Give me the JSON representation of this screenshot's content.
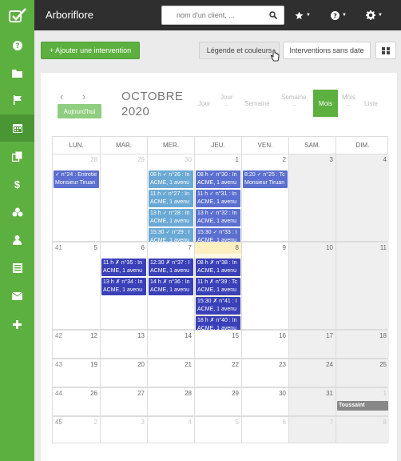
{
  "app": {
    "title": "Arboriflore",
    "colors": {
      "brand": "#5cb040",
      "topbar": "#2f2f2f",
      "event_violet": "#5b6fd0",
      "event_light": "#6aa9d5",
      "event_dark": "#3a40b8"
    }
  },
  "search": {
    "placeholder": "nom d'un client, ..."
  },
  "sidebar": {
    "items": [
      {
        "icon": "help-icon"
      },
      {
        "icon": "folder-icon"
      },
      {
        "icon": "flag-icon"
      },
      {
        "icon": "calendar-icon",
        "active": true
      },
      {
        "icon": "copy-icon"
      },
      {
        "icon": "dollar-icon"
      },
      {
        "icon": "cubes-icon"
      },
      {
        "icon": "user-icon"
      },
      {
        "icon": "list-icon"
      },
      {
        "icon": "envelope-icon"
      },
      {
        "icon": "plus-icon"
      }
    ]
  },
  "toolbar": {
    "add_label": "+ Ajouter une intervention",
    "legend_label": "Légende et couleurs",
    "no_date_label": "Interventions sans date"
  },
  "calendar": {
    "today_label": "Aujourd'hui",
    "month": "OCTOBRE",
    "year": "2020",
    "views": [
      {
        "label": "Jour",
        "sub": ""
      },
      {
        "label": "Jour",
        "sub": "--"
      },
      {
        "label": "Semaine",
        "sub": ""
      },
      {
        "label": "Semaine",
        "sub": "--"
      },
      {
        "label": "Mois",
        "sub": "",
        "active": true
      },
      {
        "label": "Mois",
        "sub": "--"
      },
      {
        "label": "Liste",
        "sub": ""
      }
    ],
    "days_of_week": [
      "LUN.",
      "MAR.",
      "MER.",
      "JEU.",
      "VEN.",
      "SAM.",
      "DIM."
    ],
    "weeks": [
      {
        "number": "",
        "days": [
          "",
          "29",
          "30",
          "1",
          "2",
          "3",
          "4"
        ],
        "first": "28",
        "events": [
          [
            {
              "l1": "✓ n°24 : Entretie",
              "l2": "Monsieur Tiruan",
              "c": "violet"
            }
          ],
          [],
          [
            {
              "l1": "08 h ✓ n°26 : In",
              "l2": "ACME, 1 avenu",
              "c": "light"
            },
            {
              "l1": "11 h ✓ n°27 : In",
              "l2": "ACME, 1 avenu",
              "c": "light"
            },
            {
              "l1": "13 h ✓ n°28 : In",
              "l2": "ACME, 1 avenu",
              "c": "light"
            },
            {
              "l1": "15:30 ✓ n°29 : I",
              "l2": "ACME, 1 avenu",
              "c": "light"
            }
          ],
          [
            {
              "l1": "08 h ✓ n°30 : In",
              "l2": "ACME, 1 avenu",
              "c": "violet"
            },
            {
              "l1": "11 h ✓ n°31 : In",
              "l2": "ACME, 1 avenu",
              "c": "violet"
            },
            {
              "l1": "13 h ✓ n°32 : In",
              "l2": "ACME, 1 avenu",
              "c": "violet"
            },
            {
              "l1": "15:30 ✓ n°33 : I",
              "l2": "ACME, 1 avenu",
              "c": "violet"
            }
          ],
          [
            {
              "l1": "8:20 ✓ n°25 : Tc",
              "l2": "Monsieur Tiruan",
              "c": "violet"
            }
          ],
          [],
          []
        ]
      },
      {
        "number": "41",
        "days": [
          "5",
          "6",
          "7",
          "8",
          "9",
          "10",
          "11"
        ],
        "events": [
          [],
          [
            {
              "l1": "11 h ✗ n°35 : In",
              "l2": "ACME, 1 avenu",
              "c": "dark"
            },
            {
              "l1": "13 h ✗ n°34 : In",
              "l2": "ACME, 1 avenu",
              "c": "dark"
            }
          ],
          [
            {
              "l1": "12:30 ✗ n°37 : I",
              "l2": "ACME, 1 avenu",
              "c": "dark"
            },
            {
              "l1": "14 h ✗ n°36 : In",
              "l2": "ACME, 1 avenu",
              "c": "dark"
            }
          ],
          [
            {
              "l1": "08 h ✗ n°38 : In",
              "l2": "ACME, 1 avenu",
              "c": "dark"
            },
            {
              "l1": "11 h ✗ n°39 : Tc",
              "l2": "ACME, 1 avenu",
              "c": "dark"
            },
            {
              "l1": "15:30 ✗ n°41 : I",
              "l2": "ACME, 1 avenu",
              "c": "dark"
            },
            {
              "l1": "18 h ✗ n°40 : In",
              "l2": "ACME, 1 avenu",
              "c": "dark"
            }
          ],
          [],
          [],
          []
        ]
      },
      {
        "number": "42",
        "days": [
          "12",
          "13",
          "14",
          "15",
          "16",
          "17",
          "18"
        ],
        "events": [
          [],
          [],
          [],
          [],
          [],
          [],
          []
        ]
      },
      {
        "number": "43",
        "days": [
          "19",
          "20",
          "21",
          "22",
          "23",
          "24",
          "25"
        ],
        "events": [
          [],
          [],
          [],
          [],
          [],
          [],
          []
        ]
      },
      {
        "number": "44",
        "days": [
          "26",
          "27",
          "28",
          "29",
          "30",
          "31",
          "1"
        ],
        "events": [
          [],
          [],
          [],
          [],
          [],
          [],
          [
            {
              "l1": "Toussaint",
              "l2": "",
              "c": "gray"
            }
          ]
        ]
      },
      {
        "number": "45",
        "days": [
          "2",
          "3",
          "4",
          "5",
          "6",
          "7",
          "8"
        ],
        "events": [
          [],
          [],
          [],
          [],
          [],
          [],
          []
        ]
      }
    ]
  }
}
